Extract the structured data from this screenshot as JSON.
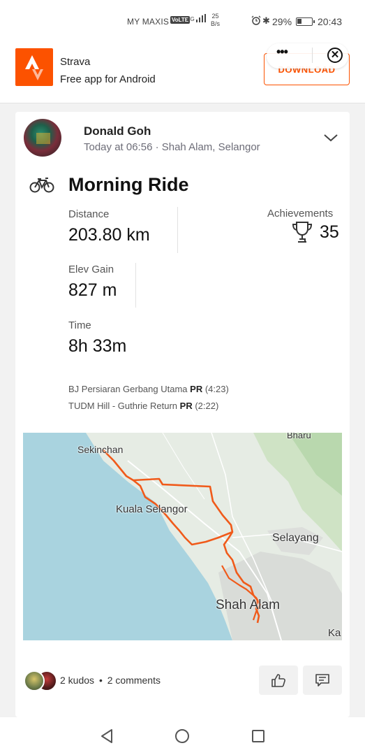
{
  "status_bar": {
    "carrier": "MY MAXIS",
    "network": "VoLTE",
    "signal": "4G",
    "speed_value": "25",
    "speed_unit": "B/s",
    "battery": "29%",
    "time": "20:43",
    "icons": [
      "alarm-icon",
      "bluetooth-icon",
      "battery-icon"
    ]
  },
  "banner": {
    "app_name": "Strava",
    "subtitle": "Free app for Android",
    "download_label": "DOWNLOAD",
    "brand_color": "#fc5200",
    "more_glyph": "•••",
    "close_glyph": "✕"
  },
  "activity": {
    "athlete": "Donald Goh",
    "meta": "Today at 06:56 · Shah Alam, Selangor",
    "title": "Morning Ride",
    "stats": {
      "distance_label": "Distance",
      "distance_value": "203.80 km",
      "elev_label": "Elev Gain",
      "elev_value": "827 m",
      "time_label": "Time",
      "time_value": "8h 33m",
      "achievements_label": "Achievements",
      "achievements_value": "35"
    },
    "segments": [
      {
        "name": "BJ Persiaran Gerbang Utama",
        "badge": "PR",
        "time": "(4:23)"
      },
      {
        "name": "TUDM Hill - Guthrie Return",
        "badge": "PR",
        "time": "(2:22)"
      }
    ]
  },
  "map": {
    "labels": {
      "sekinchan": "Sekinchan",
      "kuala_selangor": "Kuala Selangor",
      "selayang": "Selayang",
      "shah_alam": "Shah Alam",
      "bharu": "Bharu",
      "ka": "Ka"
    },
    "route_color": "#f05a1a",
    "sea_color": "#a9d3df",
    "land_color": "#e6ece4"
  },
  "social": {
    "kudos": "2 kudos",
    "separator": "•",
    "comments": "2 comments"
  }
}
